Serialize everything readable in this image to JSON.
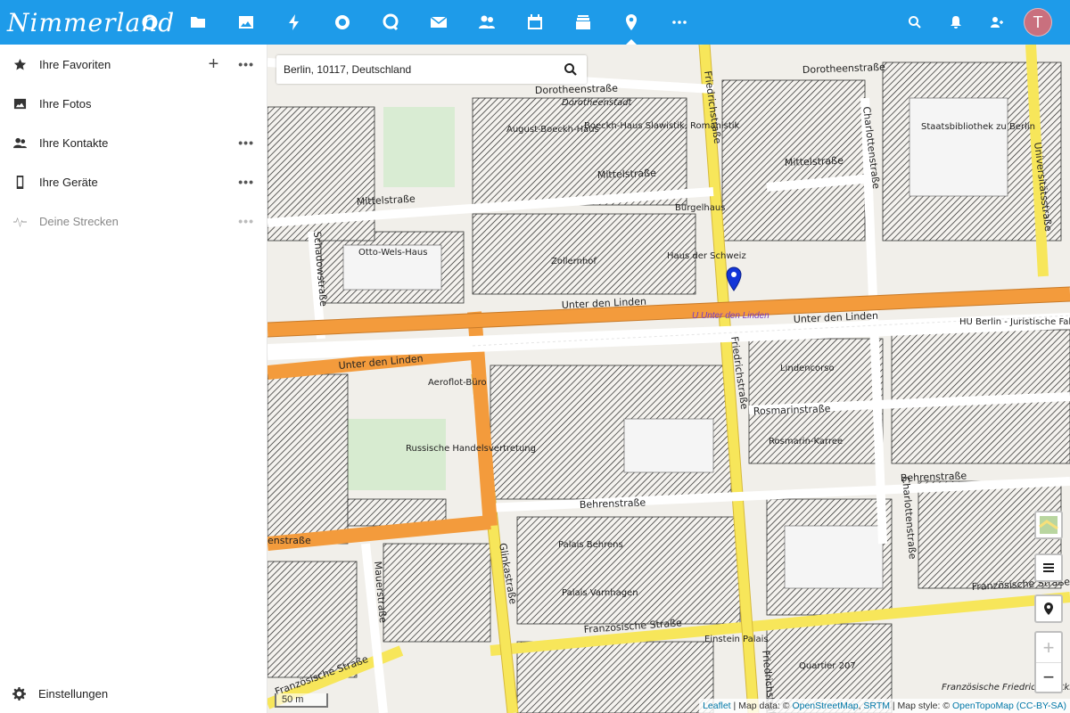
{
  "app": {
    "logo": "Nimmerland",
    "avatar_initial": "T"
  },
  "topbar_icons": [
    "dashboard-icon",
    "files-icon",
    "photos-icon",
    "activity-icon",
    "talk-icon",
    "circles-icon",
    "mail-icon",
    "contacts-icon",
    "calendar-icon",
    "deck-icon",
    "maps-icon",
    "more-apps-icon"
  ],
  "sidebar": {
    "items": [
      {
        "label": "Ihre Favoriten"
      },
      {
        "label": "Ihre Fotos"
      },
      {
        "label": "Ihre Kontakte"
      },
      {
        "label": "Ihre Geräte"
      },
      {
        "label": "Deine Strecken"
      }
    ],
    "settings": "Einstellungen"
  },
  "search": {
    "value": "Berlin, 10117, Deutschland"
  },
  "map": {
    "scale": "50 m",
    "poi_label": "U Unter den Linden",
    "attribution": {
      "leaflet": "Leaflet",
      "data": "| Map data: ©",
      "osm": "OpenStreetMap",
      "srtm": "SRTM",
      "style": "| Map style: ©",
      "otm": "OpenTopoMap",
      "license": "(CC-BY-SA)"
    },
    "streets": {
      "unter_den_linden": "Unter den Linden",
      "friedrichstrasse": "Friedrichstraße",
      "dorotheenstrasse": "Dorotheenstraße",
      "mittelstrasse": "Mittelstraße",
      "behrenstrasse": "Behrenstraße",
      "franzoesische": "Französische Straße",
      "charlottenstrasse": "Charlottenstraße",
      "universitaetsstrasse": "Universitätsstraße",
      "schadowstrasse": "Schadowstraße",
      "glinkastrasse": "Glinkastraße",
      "mauerstrasse": "Mauerstraße",
      "rosmarinstrasse": "Rosmarinstraße"
    },
    "buildings": {
      "otto_wels": "Otto-Wels-Haus",
      "zollernhof": "Zollernhof",
      "haus_schweiz": "Haus der Schweiz",
      "august_boeckh": "August-Boeckh-Haus",
      "boeckh_slawistik": "Boeckh-Haus Slawistik, Romanistik",
      "buergelhaus": "Bürgelhaus",
      "lindencorso": "Lindencorso",
      "rosmarin": "Rosmarin-Karree",
      "aeroflot": "Aeroflot-Büro",
      "handelsvertretung": "Russische Handelsvertretung",
      "palais_behrens": "Palais Behrens",
      "palais_varnhagen": "Palais Varnhagen",
      "einstein": "Einstein Palais",
      "quartier": "Quartier 207",
      "staatsbibliothek": "Staatsbibliothek zu Berlin",
      "hu_berlin": "HU Berlin - Juristische Fakultät",
      "franz_kirche": "Französische Friedrichstadtkirche",
      "dorotheenstadt": "Dorotheenstadt"
    }
  }
}
